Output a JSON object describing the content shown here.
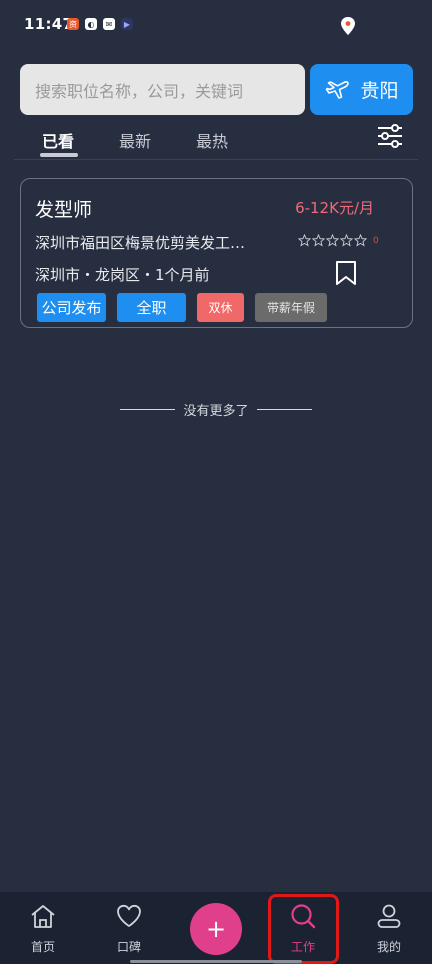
{
  "status_bar": {
    "time": "11:47",
    "icons": [
      "app-badge-icon",
      "swirl-app-icon",
      "message-icon",
      "play-icon"
    ]
  },
  "search": {
    "placeholder": "搜索职位名称，公司，关键词",
    "city": "贵阳"
  },
  "tabs": [
    {
      "label": "已看",
      "active": true
    },
    {
      "label": "最新",
      "active": false
    },
    {
      "label": "最热",
      "active": false
    }
  ],
  "job": {
    "title": "发型师",
    "salary": "6-12K元/月",
    "company": "深圳市福田区梅景优剪美发工…",
    "rating_count": "0",
    "location": "深圳市・龙岗区・1个月前",
    "tags": [
      "公司发布",
      "全职",
      "双休",
      "带薪年假"
    ]
  },
  "no_more": "没有更多了",
  "bottom_nav": [
    {
      "label": "首页",
      "icon": "home-icon"
    },
    {
      "label": "口碑",
      "icon": "heart-icon"
    },
    {
      "label": "工作",
      "icon": "search-icon",
      "active": true
    },
    {
      "label": "我的",
      "icon": "profile-icon"
    }
  ],
  "fab_symbol": "+",
  "colors": {
    "background": "#262e3f",
    "accent_blue": "#1f8ef1",
    "accent_pink": "#e0408b",
    "salary_red": "#f06a7a"
  }
}
